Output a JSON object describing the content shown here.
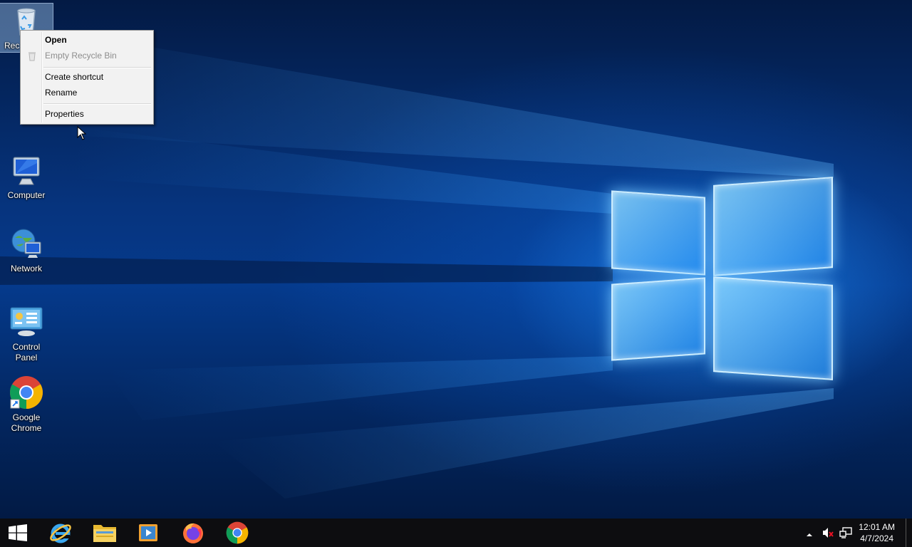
{
  "desktop": {
    "icons": [
      {
        "label": "Recycle Bin",
        "visible_label": "Rec",
        "icon": "recycle-bin-icon"
      },
      {
        "label": "",
        "icon": "folder-icon"
      },
      {
        "label": "Computer",
        "icon": "computer-icon"
      },
      {
        "label": "Network",
        "icon": "network-icon"
      },
      {
        "label_line1": "Control",
        "label_line2": "Panel",
        "icon": "control-panel-icon"
      },
      {
        "label_line1": "Google",
        "label_line2": "Chrome",
        "icon": "chrome-icon"
      }
    ]
  },
  "context_menu": {
    "items": [
      {
        "label": "Open",
        "bold": true,
        "enabled": true
      },
      {
        "label": "Empty Recycle Bin",
        "enabled": false
      },
      {
        "label": "Create shortcut",
        "enabled": true
      },
      {
        "label": "Rename",
        "enabled": true
      },
      {
        "label": "Properties",
        "enabled": true
      }
    ]
  },
  "taskbar": {
    "pinned": [
      {
        "name": "start-button",
        "icon": "windows-logo-icon"
      },
      {
        "name": "internet-explorer",
        "icon": "internet-explorer-icon"
      },
      {
        "name": "file-explorer",
        "icon": "file-explorer-icon"
      },
      {
        "name": "media-player",
        "icon": "media-player-icon"
      },
      {
        "name": "firefox",
        "icon": "firefox-icon"
      },
      {
        "name": "chrome",
        "icon": "chrome-icon"
      }
    ],
    "tray": {
      "time": "12:01 AM",
      "date": "4/7/2024"
    }
  },
  "colors": {
    "taskbar": "#0d0d10",
    "menu_bg": "#f2f2f2",
    "disabled_text": "#8d8d8d"
  }
}
